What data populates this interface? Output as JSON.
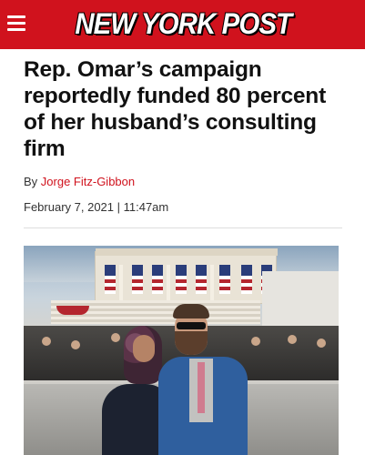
{
  "header": {
    "logo_text": "NEW YORK POST",
    "menu_icon": "hamburger-menu-icon",
    "background_color": "#d0121d"
  },
  "article": {
    "headline": "Rep. Omar’s campaign reportedly funded 80 percent of her husband’s consulting firm",
    "byline_prefix": "By",
    "author": "Jorge Fitz-Gibbon",
    "date": "February 7, 2021 | 11:47am"
  },
  "colors": {
    "accent": "#d0121d",
    "text": "#111111"
  }
}
